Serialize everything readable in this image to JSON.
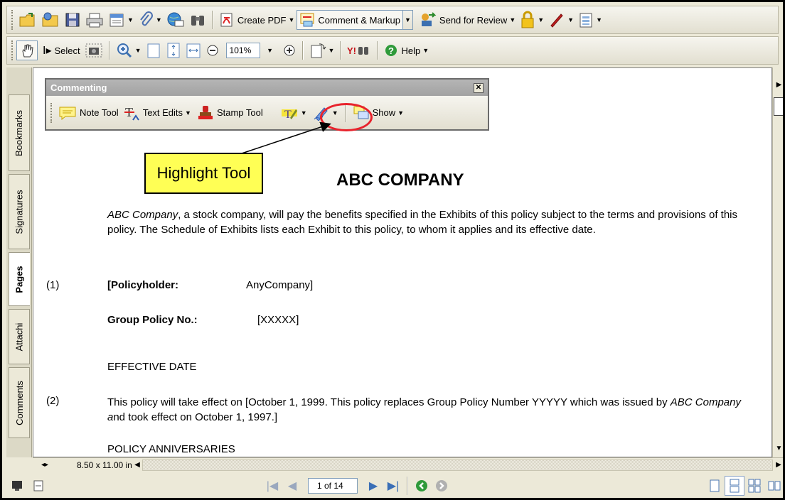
{
  "toolbar1": {
    "create_pdf": "Create PDF",
    "comment_markup": "Comment & Markup",
    "send_review": "Send for Review"
  },
  "toolbar2": {
    "select": "Select",
    "zoom": "101%",
    "help": "Help"
  },
  "nav_tabs": [
    "Bookmarks",
    "Signatures",
    "Pages",
    "Attachi",
    "Comments"
  ],
  "commenting": {
    "title": "Commenting",
    "note_tool": "Note Tool",
    "text_edits": "Text Edits",
    "stamp_tool": "Stamp Tool",
    "show": "Show"
  },
  "callout": {
    "label": "Highlight Tool",
    "color": "#ffff55",
    "ellipse_color": "#e8232c"
  },
  "document": {
    "company": "ABC COMPANY",
    "para1_italic": "ABC Company",
    "para1_rest": ", a stock company, will pay the benefits specified in the Exhibits of this policy subject to the terms and provisions of this policy.  The Schedule of Exhibits lists each Exhibit to this policy, to whom it applies and its effective date.",
    "item1_num": "(1)",
    "policyholder_label": "[Policyholder:",
    "policyholder_value": "AnyCompany]",
    "group_label": "Group Policy No.:",
    "group_value": "[XXXXX]",
    "effective_heading": "EFFECTIVE DATE",
    "item2_num": "(2)",
    "para2_a": "This policy will take effect on [October 1, 1999.  This policy replaces Group Policy Number YYYYY which was issued by ",
    "para2_italic": "ABC Company a",
    "para2_b": "nd took effect on October 1, 1997.]",
    "anniversaries_heading": "POLICY ANNIVERSARIES"
  },
  "page_size": "8.50 x 11.00 in",
  "status": {
    "page_display": "1 of 14"
  }
}
